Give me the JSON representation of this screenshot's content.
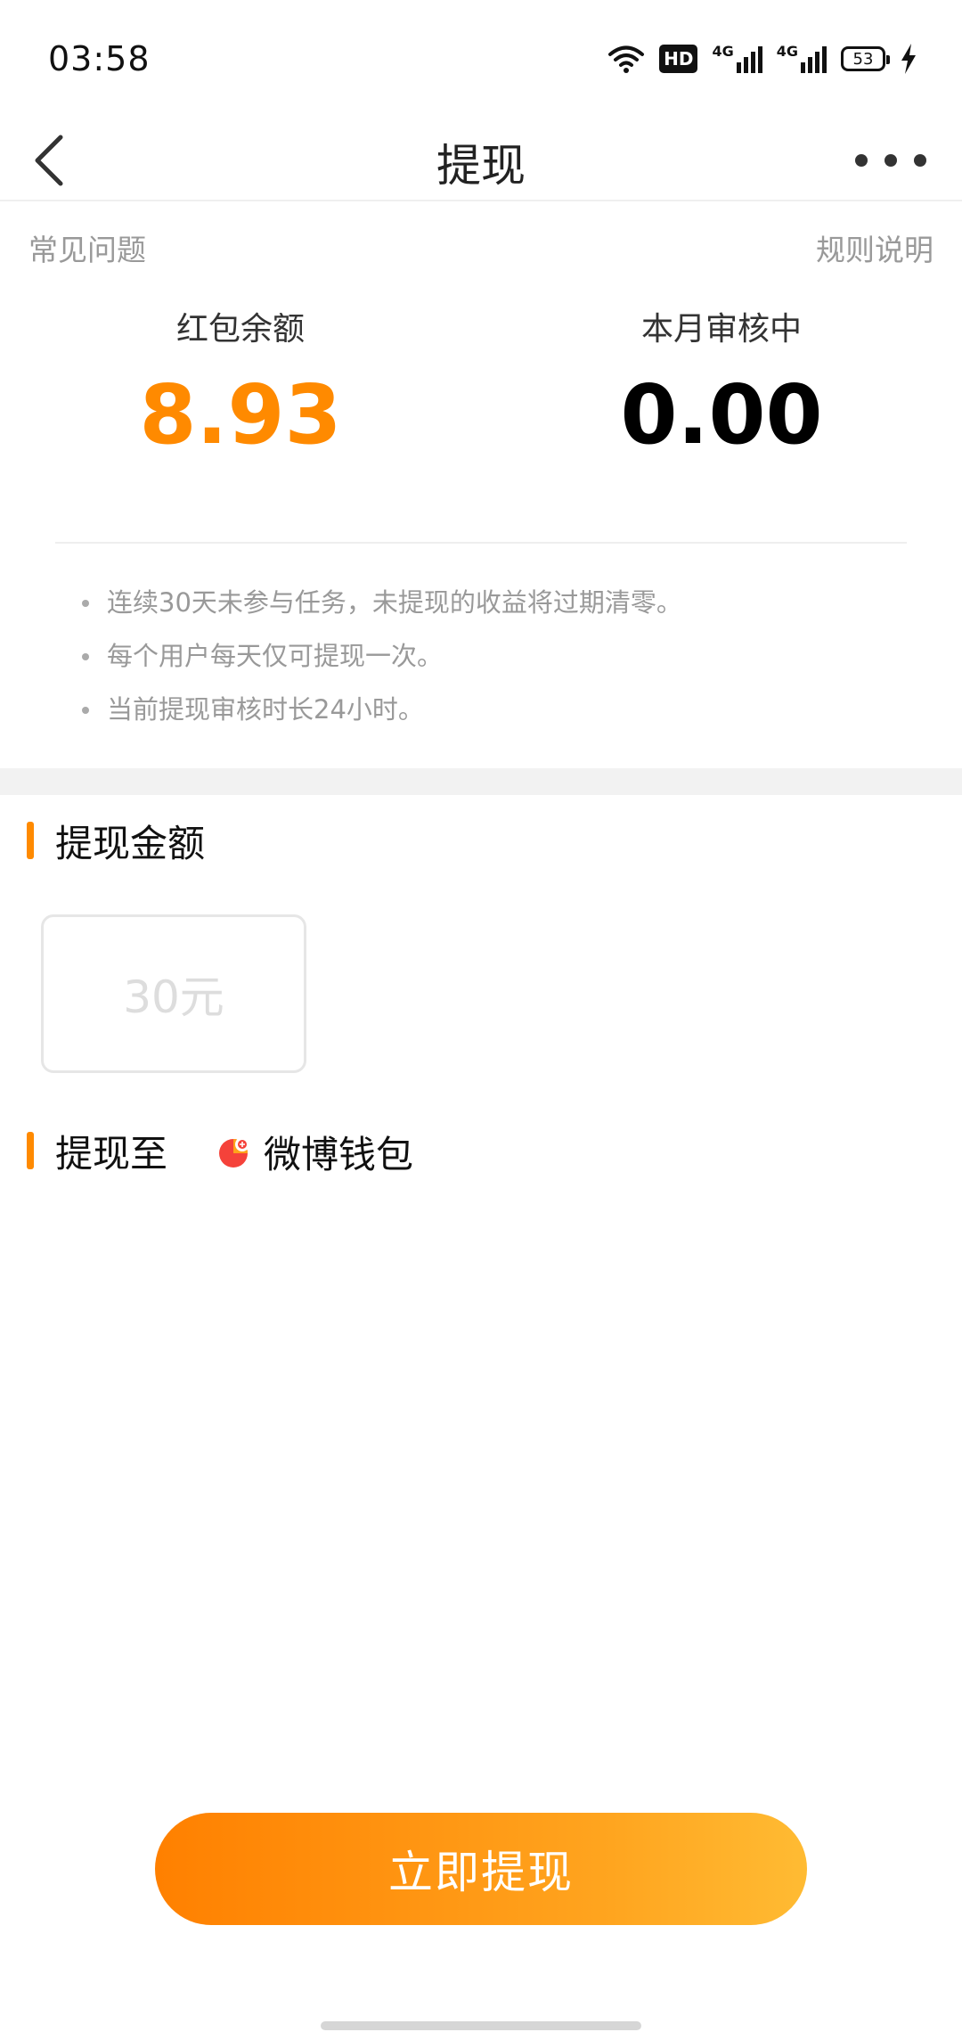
{
  "status_bar": {
    "time": "03:58",
    "hd_badge": "HD",
    "network_1": "4G",
    "network_2": "4G",
    "battery": "53"
  },
  "header": {
    "title": "提现"
  },
  "links": {
    "faq": "常见问题",
    "rules": "规则说明"
  },
  "balances": {
    "red_packet_label": "红包余额",
    "red_packet_value": "8.93",
    "reviewing_label": "本月审核中",
    "reviewing_value": "0.00"
  },
  "notes": [
    "连续30天未参与任务，未提现的收益将过期清零。",
    "每个用户每天仅可提现一次。",
    "当前提现审核时长24小时。"
  ],
  "withdraw_amount": {
    "title": "提现金额",
    "options": [
      "30元"
    ]
  },
  "withdraw_to": {
    "title": "提现至",
    "wallet": "微博钱包"
  },
  "actions": {
    "withdraw_now": "立即提现"
  },
  "colors": {
    "accent": "#ff8a00",
    "muted_text": "#999999"
  }
}
